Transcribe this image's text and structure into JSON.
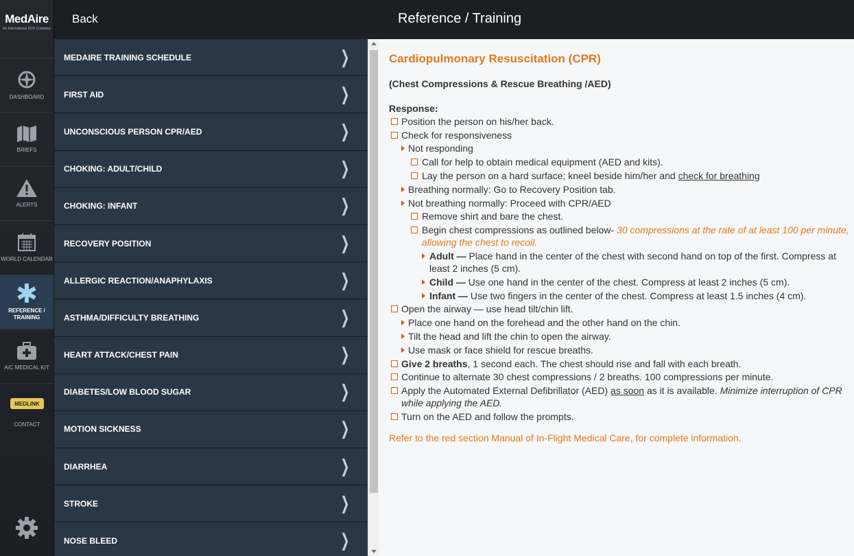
{
  "app": {
    "logo": "MedAire",
    "logo_sub": "An International SOS Company"
  },
  "header": {
    "back_label": "Back",
    "title": "Reference / Training"
  },
  "rail": {
    "items": [
      {
        "label": "DASHBOARD",
        "icon": "compass-icon"
      },
      {
        "label": "BRIEFS",
        "icon": "map-icon"
      },
      {
        "label": "ALERTS",
        "icon": "warning-icon"
      },
      {
        "label": "WORLD CALENDAR",
        "icon": "calendar-icon"
      },
      {
        "label": "REFERENCE / TRAINING",
        "icon": "medical-star-icon"
      },
      {
        "label": "A/C MEDICAL KIT",
        "icon": "medical-kit-icon"
      }
    ],
    "medlink": "MEDLINK",
    "contact": "CONTACT",
    "settings_icon": "gear-icon"
  },
  "menu": {
    "items": [
      "MEDAIRE TRAINING SCHEDULE",
      "FIRST AID",
      "UNCONSCIOUS PERSON CPR/AED",
      "CHOKING: ADULT/CHILD",
      "CHOKING: INFANT",
      "RECOVERY POSITION",
      "ALLERGIC REACTION/ANAPHYLAXIS",
      "ASTHMA/DIFFICULTY BREATHING",
      "HEART ATTACK/CHEST PAIN",
      "DIABETES/LOW BLOOD SUGAR",
      "MOTION SICKNESS",
      "DIARRHEA",
      "STROKE",
      "NOSE BLEED"
    ]
  },
  "content": {
    "title": "Cardiopulmonary Resuscitation (CPR)",
    "subtitle": "(Chest Compressions & Rescue Breathing /AED)",
    "response_label": "Response:",
    "s1": "Position the person on his/her back.",
    "s2": "Check for responsiveness",
    "s2a": "Not responding",
    "s2a1": "Call for help to obtain medical equipment (AED and kits).",
    "s2a2_pre": "Lay the person on a hard surface; kneel beside him/her and ",
    "s2a2_link": "check for breathing",
    "s2b": "Breathing normally: Go to Recovery Position tab.",
    "s2c": "Not breathing normally: Proceed with CPR/AED",
    "s2c1": "Remove shirt and bare the chest.",
    "s2c2_pre": "Begin chest compressions as outlined below- ",
    "s2c2_em": "30 compressions at the rate of at least 100 per minute, allowing the chest to recoil.",
    "adult_label": "Adult —",
    "adult_text": " Place hand in the center of the chest with second hand on top of the first. Compress at least 2 inches (5 cm).",
    "child_label": "Child —",
    "child_text": " Use one hand in the center of the chest. Compress at least 2 inches (5 cm).",
    "infant_label": "Infant —",
    "infant_text": " Use two fingers in the center of the chest. Compress at least 1.5 inches (4 cm).",
    "s3": "Open the airway — use head tilt/chin lift.",
    "s3a": "Place one hand on the forehead and the other hand on the chin.",
    "s3b": "Tilt the head and lift the chin to open the airway.",
    "s3c": "Use mask or face shield for rescue breaths.",
    "s4_bold": "Give 2 breaths",
    "s4_text": ", 1 second each. The chest should rise and fall with each breath.",
    "s5": "Continue to alternate 30 chest compressions / 2 breaths. 100 compressions per minute.",
    "s6_pre": "Apply the Automated External Defibrillator (AED) ",
    "s6_link": "as soon",
    "s6_mid": " as it is available. ",
    "s6_em": "Minimize interruption of CPR while applying the AED.",
    "s7": "Turn on the AED and follow the prompts.",
    "refer": "Refer to the red section Manual of In-Flight Medical Care, for complete information."
  },
  "colors": {
    "accent_orange": "#e07a1e",
    "menu_bg": "#2b3744",
    "active_rail": "#2a3d52",
    "medlink_badge": "#e5c75a"
  }
}
